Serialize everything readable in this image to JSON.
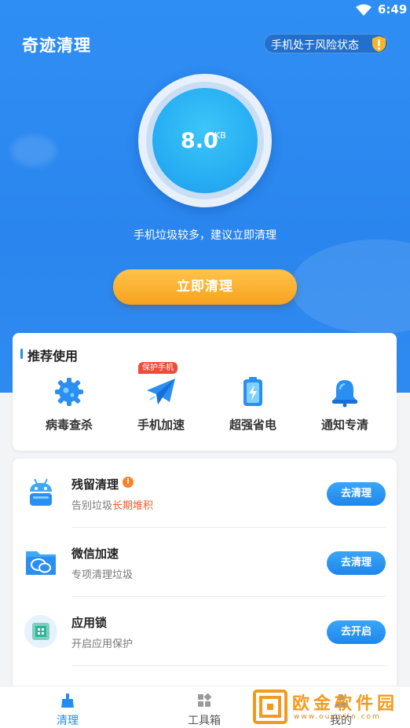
{
  "status_bar": {
    "time": "6:49",
    "wifi_icon": "wifi-icon"
  },
  "header": {
    "app_title": "奇迹清理",
    "risk_badge": "手机处于风险状态",
    "risk_icon": "warning-shield-icon"
  },
  "gauge": {
    "value": "8.0",
    "unit": "KB",
    "hint": "手机垃圾较多，建议立即清理"
  },
  "clean_button": "立即清理",
  "recommend": {
    "title": "推荐使用",
    "items": [
      {
        "label": "病毒查杀",
        "icon": "virus-gear-icon"
      },
      {
        "label": "手机加速",
        "icon": "paper-plane-icon",
        "badge": "保护手机"
      },
      {
        "label": "超强省电",
        "icon": "battery-icon"
      },
      {
        "label": "通知专清",
        "icon": "bell-icon"
      }
    ]
  },
  "features": [
    {
      "title": "残留清理",
      "sub_prefix": "告别垃圾",
      "sub_highlight": "长期堆积",
      "button": "去清理",
      "icon": "android-icon",
      "alert": "!"
    },
    {
      "title": "微信加速",
      "sub_prefix": "专项清理垃圾",
      "sub_highlight": "",
      "button": "去清理",
      "icon": "wechat-folder-icon"
    },
    {
      "title": "应用锁",
      "sub_prefix": "开启应用保护",
      "sub_highlight": "",
      "button": "去开启",
      "icon": "app-lock-icon"
    }
  ],
  "bottom_nav": [
    {
      "label": "清理",
      "icon": "broom-icon",
      "active": true
    },
    {
      "label": "工具箱",
      "icon": "toolbox-grid-icon",
      "active": false
    },
    {
      "label": "我的",
      "icon": "user-icon",
      "active": false
    }
  ],
  "watermark": {
    "text": "欧金软件园",
    "url": "www.oujinjin.com"
  },
  "colors": {
    "primary": "#1f8ef0",
    "accent": "#f7a21e",
    "alert": "#f05a2a",
    "hero": "#2a86ee"
  }
}
